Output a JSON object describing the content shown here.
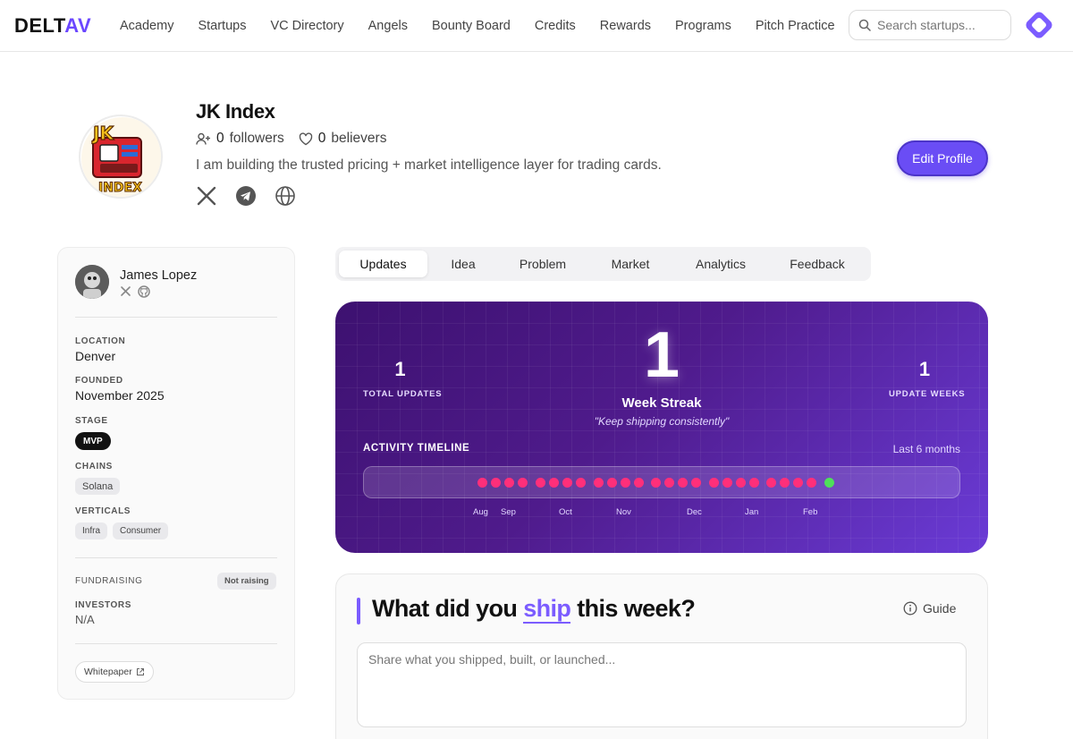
{
  "nav": {
    "logo_main": "DELT",
    "logo_accent": "AV",
    "links": [
      "Academy",
      "Startups",
      "VC Directory",
      "Angels",
      "Bounty Board",
      "Credits",
      "Rewards",
      "Programs",
      "Pitch Practice"
    ],
    "search_placeholder": "Search startups...",
    "brand_color": "#6b47ff"
  },
  "profile": {
    "name": "JK Index",
    "avatar_text_top": "JK",
    "avatar_text_bottom": "INDEX",
    "followers_count": "0",
    "followers_label": "followers",
    "believers_count": "0",
    "believers_label": "believers",
    "bio": "I am building the trusted pricing + market intelligence layer for trading cards.",
    "socials": [
      "x-icon",
      "telegram-icon",
      "globe-icon"
    ],
    "edit_label": "Edit Profile"
  },
  "sidebar": {
    "founder_name": "James Lopez",
    "location_label": "LOCATION",
    "location": "Denver",
    "founded_label": "FOUNDED",
    "founded": "November 2025",
    "stage_label": "STAGE",
    "stage": "MVP",
    "chains_label": "CHAINS",
    "chains": [
      "Solana"
    ],
    "verticals_label": "VERTICALS",
    "verticals": [
      "Infra",
      "Consumer"
    ],
    "fundraising_label": "FUNDRAISING",
    "fundraising": "Not raising",
    "investors_label": "INVESTORS",
    "investors": "N/A",
    "whitepaper_label": "Whitepaper"
  },
  "tabs": [
    {
      "label": "Updates",
      "active": true
    },
    {
      "label": "Idea",
      "active": false
    },
    {
      "label": "Problem",
      "active": false
    },
    {
      "label": "Market",
      "active": false
    },
    {
      "label": "Analytics",
      "active": false
    },
    {
      "label": "Feedback",
      "active": false
    }
  ],
  "streak": {
    "total_updates": "1",
    "total_updates_label": "TOTAL UPDATES",
    "week_streak": "1",
    "week_streak_label": "Week Streak",
    "quote": "\"Keep shipping consistently\"",
    "update_weeks": "1",
    "update_weeks_label": "UPDATE WEEKS",
    "timeline_title": "ACTIVITY TIMELINE",
    "timeline_range": "Last 6 months",
    "months": [
      "Aug",
      "Sep",
      "Oct",
      "Nov",
      "Dec",
      "Jan",
      "Feb"
    ],
    "active_color": "#ff2f7a",
    "current_color": "#4ee05a"
  },
  "ship": {
    "title_before": "What did you ",
    "title_highlight": "ship",
    "title_after": " this week?",
    "guide_label": "Guide",
    "input_placeholder": "Share what you shipped, built, or launched..."
  }
}
